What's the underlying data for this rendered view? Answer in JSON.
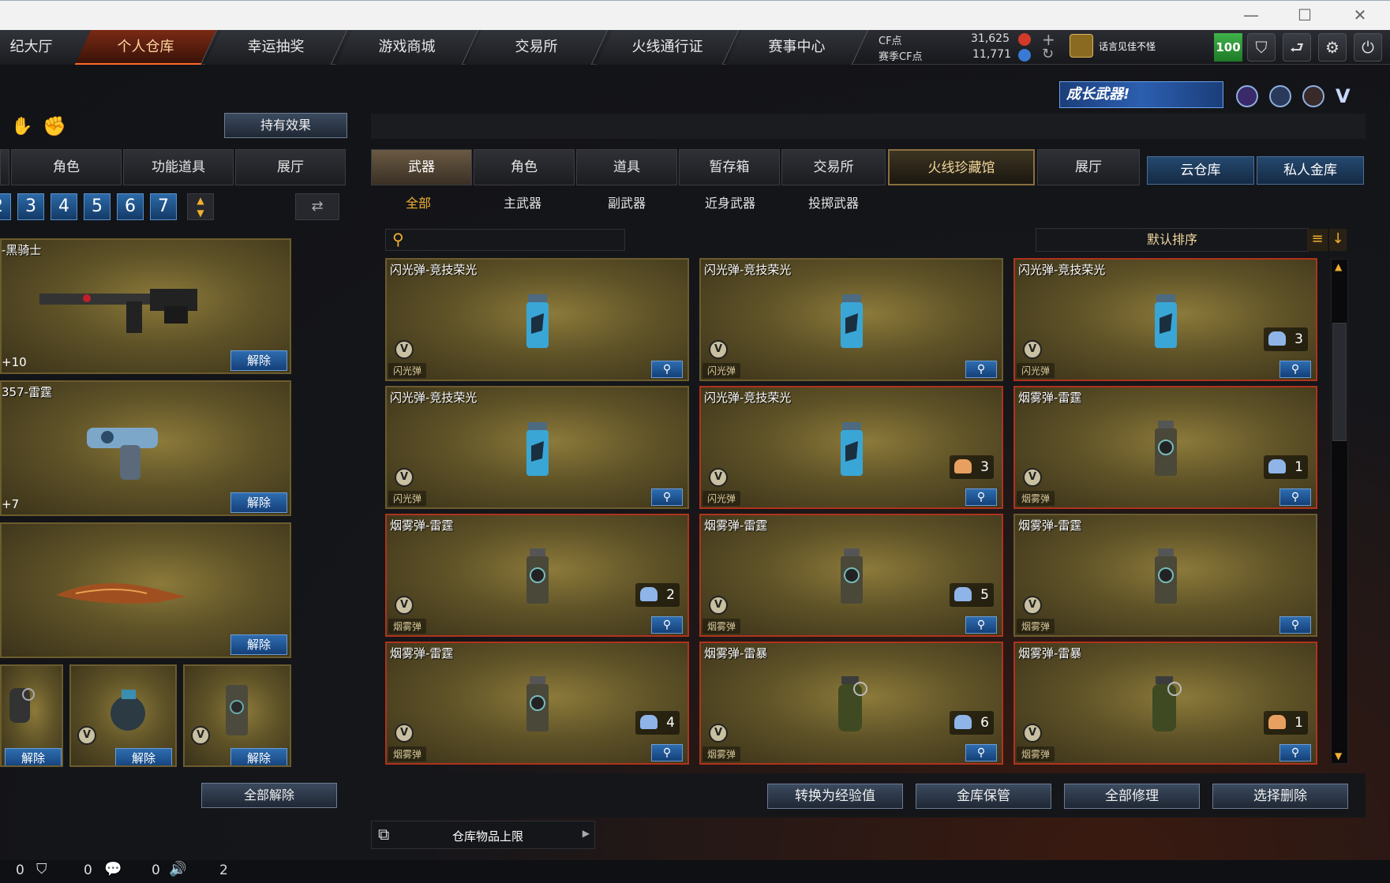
{
  "nav": {
    "tabs": [
      "纪大厅",
      "个人仓库",
      "幸运抽奖",
      "游戏商城",
      "交易所",
      "火线通行证",
      "赛事中心"
    ],
    "active": "个人仓库"
  },
  "currency": {
    "cf_label": "CF点",
    "cf_value": "31,625",
    "season_label": "赛季CF点",
    "season_value": "11,771"
  },
  "clan": {
    "name": "话言见佳不怪"
  },
  "level": "100",
  "banner": "成长武器!",
  "left": {
    "hold_effect": "持有效果",
    "tabs": [
      "角色",
      "功能道具",
      "展厅"
    ],
    "pages": [
      "2",
      "3",
      "4",
      "5",
      "6",
      "7"
    ],
    "cards": [
      {
        "name": "-黑骑士",
        "plus": "+10",
        "release": "解除"
      },
      {
        "name": "357-雷霆",
        "plus": "+7",
        "release": "解除"
      },
      {
        "name": "",
        "plus": "",
        "release": "解除"
      }
    ],
    "small_release": "解除",
    "release_all": "全部解除"
  },
  "right": {
    "tabs": [
      "武器",
      "角色",
      "道具",
      "暂存箱",
      "交易所",
      "火线珍藏馆",
      "展厅"
    ],
    "active_tab": "武器",
    "gold_tab": "火线珍藏馆",
    "cloud": [
      "云仓库",
      "私人金库"
    ],
    "subtabs": [
      "全部",
      "主武器",
      "副武器",
      "近身武器",
      "投掷武器"
    ],
    "active_subtab": "全部",
    "search_placeholder": "",
    "sort": "默认排序",
    "items": [
      {
        "name": "闪光弹-竞技荣光",
        "type": "闪光弹",
        "count": "",
        "red": false,
        "kind": "flash"
      },
      {
        "name": "闪光弹-竞技荣光",
        "type": "闪光弹",
        "count": "",
        "red": false,
        "kind": "flash"
      },
      {
        "name": "闪光弹-竞技荣光",
        "type": "闪光弹",
        "count": "3",
        "red": true,
        "kind": "flash",
        "badge": "blue"
      },
      {
        "name": "闪光弹-竞技荣光",
        "type": "闪光弹",
        "count": "",
        "red": false,
        "kind": "flash"
      },
      {
        "name": "闪光弹-竞技荣光",
        "type": "闪光弹",
        "count": "3",
        "red": true,
        "kind": "flash",
        "badge": "orange"
      },
      {
        "name": "烟雾弹-雷霆",
        "type": "烟雾弹",
        "count": "1",
        "red": true,
        "kind": "smoke",
        "badge": "blue"
      },
      {
        "name": "烟雾弹-雷霆",
        "type": "烟雾弹",
        "count": "2",
        "red": true,
        "kind": "smoke",
        "badge": "blue"
      },
      {
        "name": "烟雾弹-雷霆",
        "type": "烟雾弹",
        "count": "5",
        "red": true,
        "kind": "smoke",
        "badge": "blue"
      },
      {
        "name": "烟雾弹-雷霆",
        "type": "烟雾弹",
        "count": "",
        "red": false,
        "kind": "smoke"
      },
      {
        "name": "烟雾弹-雷霆",
        "type": "烟雾弹",
        "count": "4",
        "red": true,
        "kind": "smoke",
        "badge": "blue"
      },
      {
        "name": "烟雾弹-雷暴",
        "type": "烟雾弹",
        "count": "6",
        "red": true,
        "kind": "frag",
        "badge": "blue"
      },
      {
        "name": "烟雾弹-雷暴",
        "type": "烟雾弹",
        "count": "1",
        "red": true,
        "kind": "frag",
        "badge": "orange"
      }
    ],
    "actions": [
      "转换为经验值",
      "金库保管",
      "全部修理",
      "选择删除"
    ],
    "limit_label": "仓库物品上限"
  },
  "status": {
    "v1": "0",
    "v2": "0",
    "v3": "0",
    "v4": "2"
  }
}
